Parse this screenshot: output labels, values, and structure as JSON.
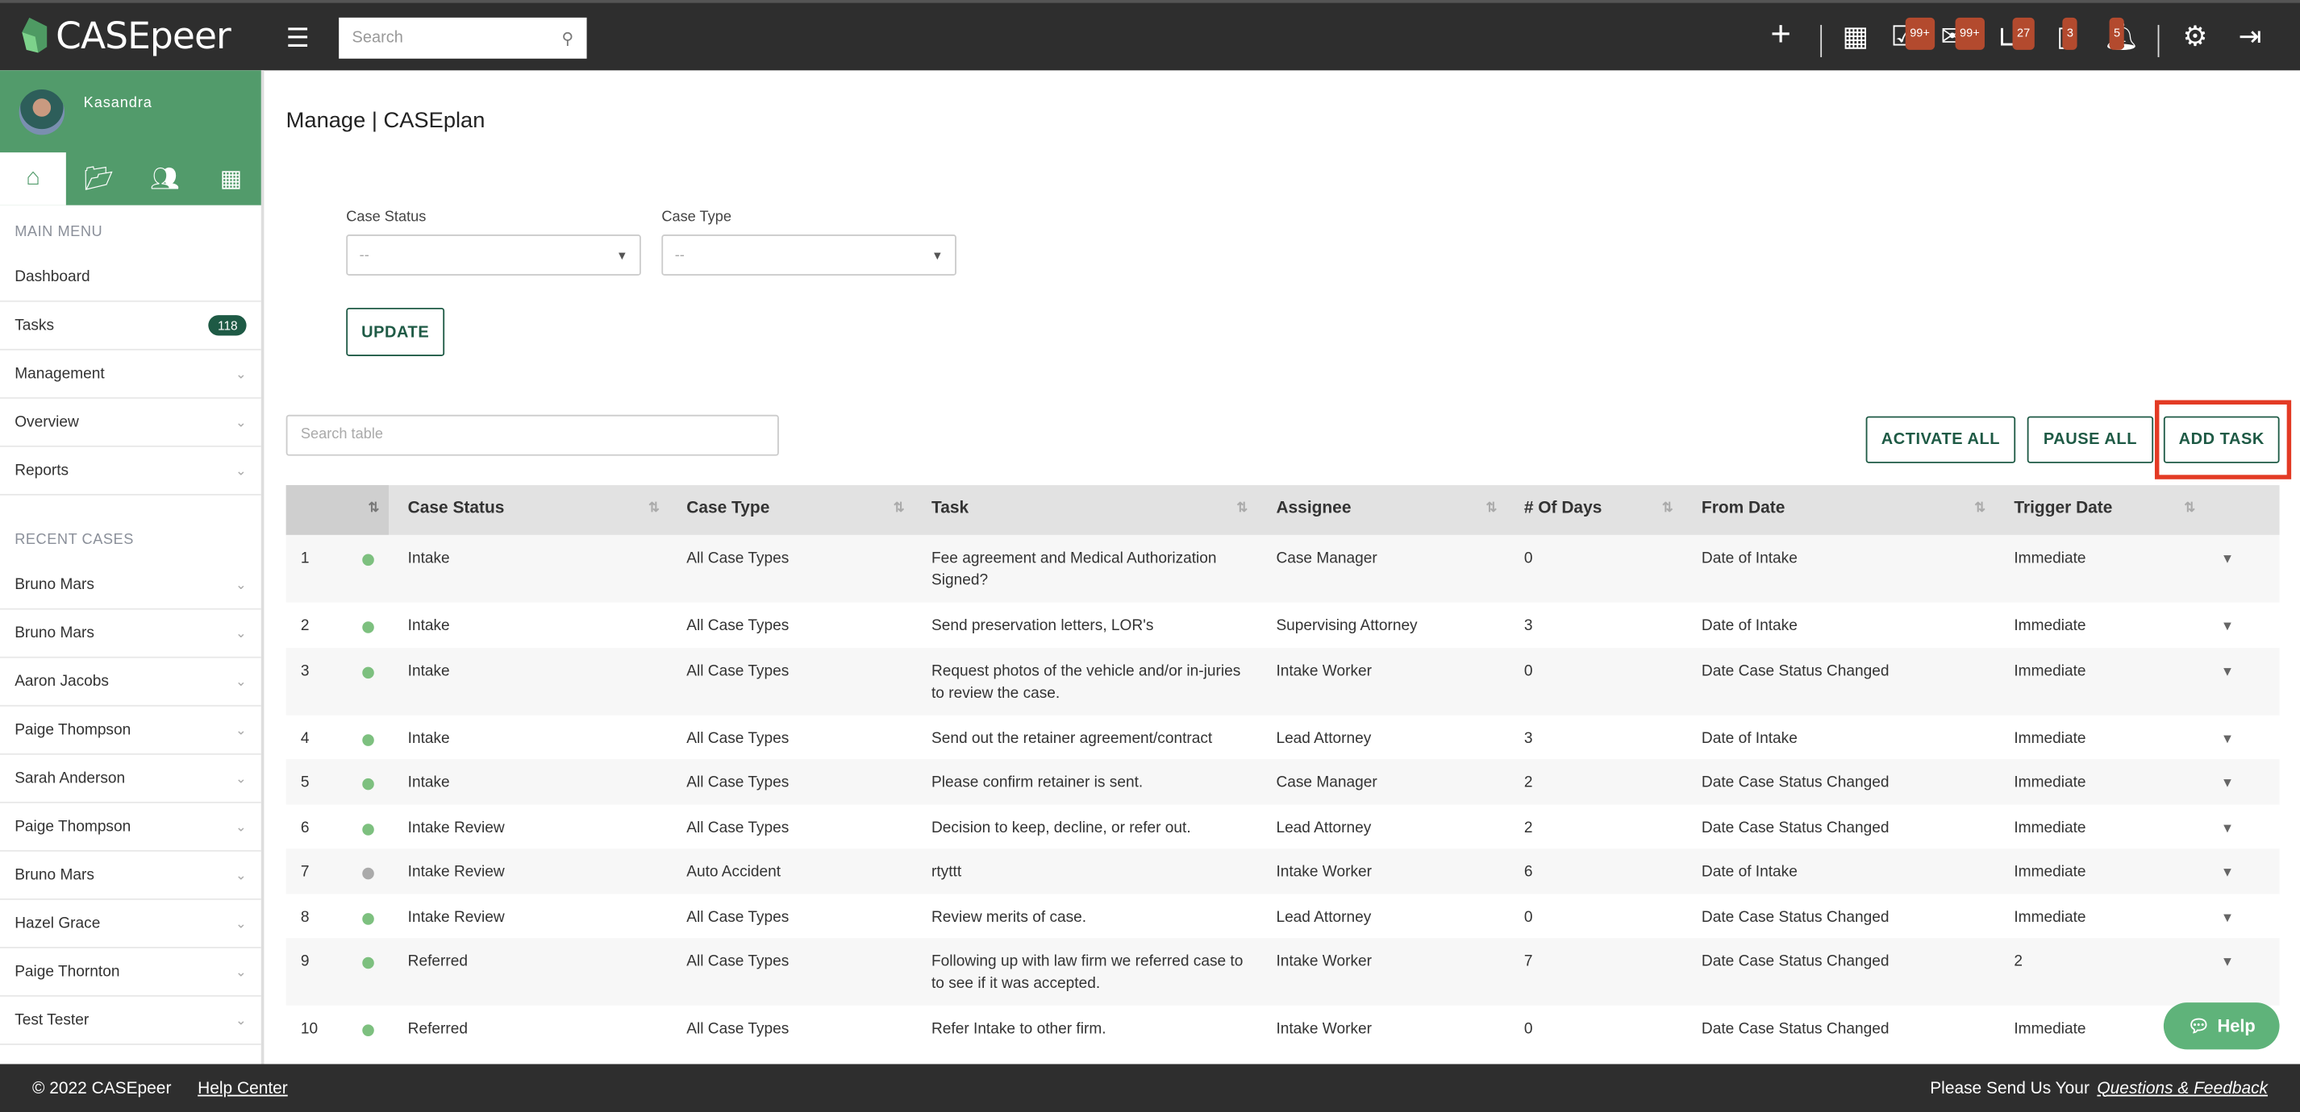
{
  "app": {
    "logo": "CASEpeer",
    "search_placeholder": "Search"
  },
  "topbar": {
    "badges": {
      "tasks": "99+",
      "mail": "99+",
      "inbox": "27",
      "phone": "3",
      "notifications": "5"
    }
  },
  "user": {
    "name": "Kasandra"
  },
  "sidebar": {
    "main_menu_heading": "MAIN MENU",
    "main_menu": [
      {
        "label": "Dashboard"
      },
      {
        "label": "Tasks",
        "count": "118"
      },
      {
        "label": "Management"
      },
      {
        "label": "Overview"
      },
      {
        "label": "Reports"
      }
    ],
    "recent_heading": "RECENT CASES",
    "recent": [
      "Bruno Mars",
      "Bruno Mars",
      "Aaron Jacobs",
      "Paige Thompson",
      "Sarah Anderson",
      "Paige Thompson",
      "Bruno Mars",
      "Hazel Grace",
      "Paige Thornton",
      "Test Tester"
    ]
  },
  "page": {
    "title": "Manage | CASEplan"
  },
  "filters": {
    "case_status_label": "Case Status",
    "case_status_value": "--",
    "case_type_label": "Case Type",
    "case_type_value": "--",
    "update": "UPDATE"
  },
  "table_tools": {
    "search_placeholder": "Search table",
    "activate_all": "ACTIVATE ALL",
    "pause_all": "PAUSE ALL",
    "add_task": "ADD TASK"
  },
  "colors": {
    "active": "#7dc07f",
    "paused": "#aaaaaa",
    "brand": "#529b6b",
    "highlight": "#e33a24"
  },
  "table": {
    "headers": [
      "Case Status",
      "Case Type",
      "Task",
      "Assignee",
      "# Of Days",
      "From Date",
      "Trigger Date"
    ],
    "rows": [
      {
        "n": "1",
        "active": true,
        "status": "Intake",
        "type": "All Case Types",
        "task": "Fee agreement and Medical Authorization Signed?",
        "assignee": "Case Manager",
        "days": "0",
        "from": "Date of Intake",
        "trigger": "Immediate"
      },
      {
        "n": "2",
        "active": true,
        "status": "Intake",
        "type": "All Case Types",
        "task": "Send preservation letters, LOR's",
        "assignee": "Supervising Attorney",
        "days": "3",
        "from": "Date of Intake",
        "trigger": "Immediate"
      },
      {
        "n": "3",
        "active": true,
        "status": "Intake",
        "type": "All Case Types",
        "task": "Request photos of the vehicle and/or in-juries to review the case.",
        "assignee": "Intake Worker",
        "days": "0",
        "from": "Date Case Status Changed",
        "trigger": "Immediate"
      },
      {
        "n": "4",
        "active": true,
        "status": "Intake",
        "type": "All Case Types",
        "task": "Send out the retainer agreement/contract",
        "assignee": "Lead Attorney",
        "days": "3",
        "from": "Date of Intake",
        "trigger": "Immediate"
      },
      {
        "n": "5",
        "active": true,
        "status": "Intake",
        "type": "All Case Types",
        "task": "Please confirm retainer is sent.",
        "assignee": "Case Manager",
        "days": "2",
        "from": "Date Case Status Changed",
        "trigger": "Immediate"
      },
      {
        "n": "6",
        "active": true,
        "status": "Intake Review",
        "type": "All Case Types",
        "task": "Decision to keep, decline, or refer out.",
        "assignee": "Lead Attorney",
        "days": "2",
        "from": "Date Case Status Changed",
        "trigger": "Immediate"
      },
      {
        "n": "7",
        "active": false,
        "status": "Intake Review",
        "type": "Auto Accident",
        "task": "rtyttt",
        "assignee": "Intake Worker",
        "days": "6",
        "from": "Date of Intake",
        "trigger": "Immediate"
      },
      {
        "n": "8",
        "active": true,
        "status": "Intake Review",
        "type": "All Case Types",
        "task": "Review merits of case.",
        "assignee": "Lead Attorney",
        "days": "0",
        "from": "Date Case Status Changed",
        "trigger": "Immediate"
      },
      {
        "n": "9",
        "active": true,
        "status": "Referred",
        "type": "All Case Types",
        "task": "Following up with law firm we referred case to to see if it was accepted.",
        "assignee": "Intake Worker",
        "days": "7",
        "from": "Date Case Status Changed",
        "trigger": "2"
      },
      {
        "n": "10",
        "active": true,
        "status": "Referred",
        "type": "All Case Types",
        "task": "Refer Intake to other firm.",
        "assignee": "Intake Worker",
        "days": "0",
        "from": "Date Case Status Changed",
        "trigger": "Immediate"
      }
    ]
  },
  "help": {
    "label": "Help"
  },
  "footer": {
    "copyright": "© 2022 CASEpeer",
    "help_center": "Help Center",
    "feedback_prefix": "Please Send Us Your",
    "feedback_link": "Questions & Feedback"
  }
}
